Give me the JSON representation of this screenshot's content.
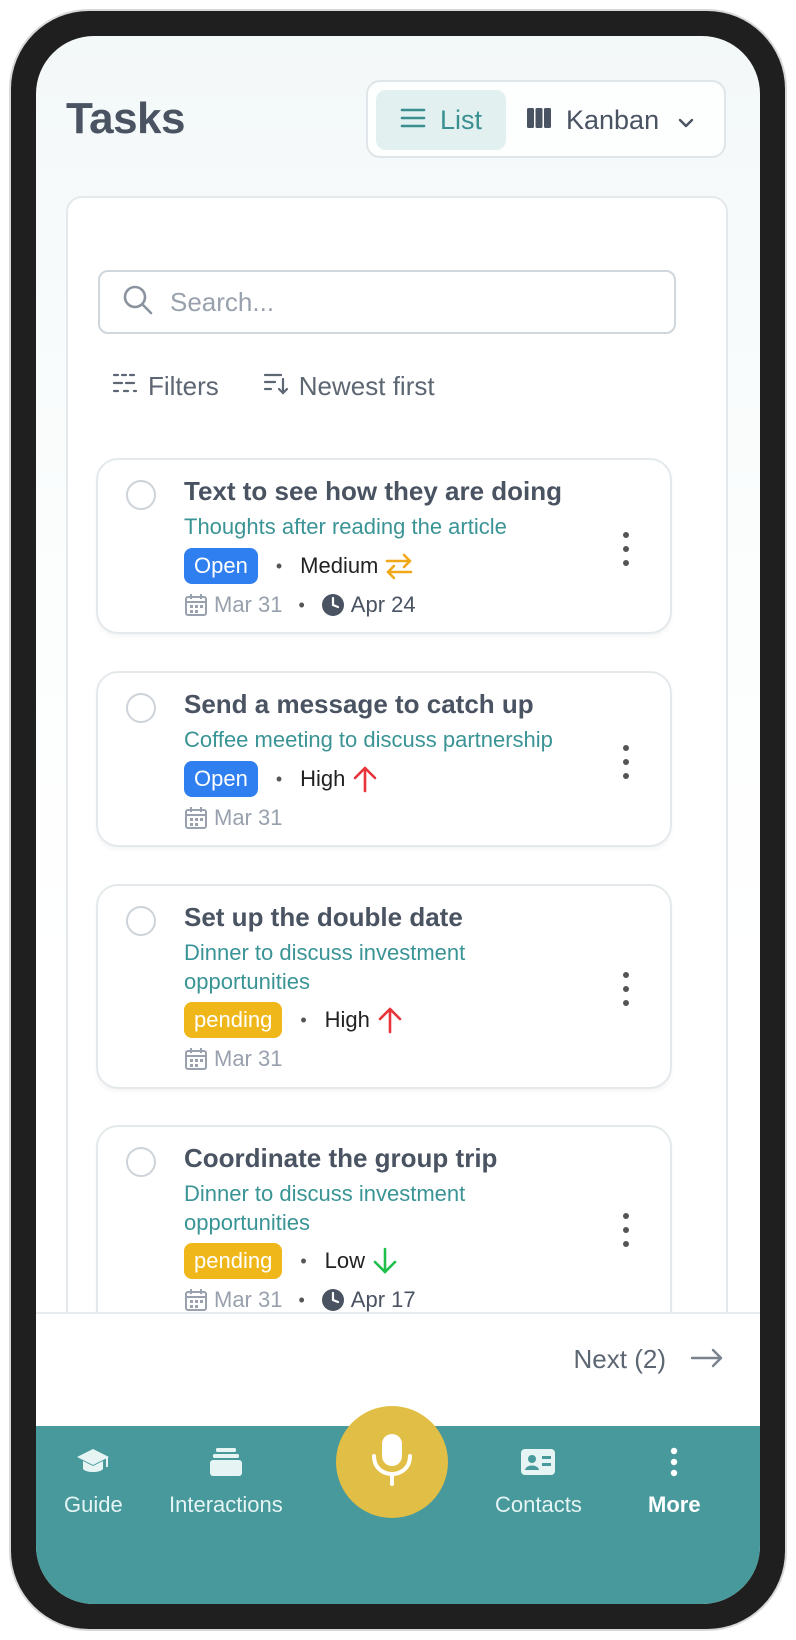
{
  "header": {
    "title": "Tasks",
    "view_list_label": "List",
    "view_kanban_label": "Kanban"
  },
  "search": {
    "placeholder": "Search..."
  },
  "toolbar": {
    "filters_label": "Filters",
    "sort_label": "Newest first"
  },
  "tasks": [
    {
      "title": "Text to see how they are doing",
      "subtitle": "Thoughts after reading the article",
      "status": "Open",
      "priority": "Medium",
      "priority_icon": "swap-arrows-icon",
      "created": "Mar 31",
      "due": "Apr 24"
    },
    {
      "title": "Send a message to catch up",
      "subtitle": "Coffee meeting to discuss partnership",
      "status": "Open",
      "priority": "High",
      "priority_icon": "arrow-up-icon",
      "created": "Mar 31"
    },
    {
      "title": "Set up the double date",
      "subtitle": "Dinner to discuss investment opportunities",
      "status": "pending",
      "priority": "High",
      "priority_icon": "arrow-up-icon",
      "created": "Mar 31"
    },
    {
      "title": "Coordinate the group trip",
      "subtitle": "Dinner to discuss investment opportunities",
      "status": "pending",
      "priority": "Low",
      "priority_icon": "arrow-down-icon",
      "created": "Mar 31",
      "due": "Apr 17"
    }
  ],
  "pagination": {
    "next_label": "Next (2)"
  },
  "nav": {
    "guide": "Guide",
    "interactions": "Interactions",
    "contacts": "Contacts",
    "more": "More"
  },
  "colors": {
    "accent": "#47999b",
    "open": "#2f7ff0",
    "pending": "#f0b71a",
    "mic": "#e1be45",
    "priority_medium": "#f0a818",
    "priority_high": "#e8343a",
    "priority_low": "#1fbf4a"
  }
}
